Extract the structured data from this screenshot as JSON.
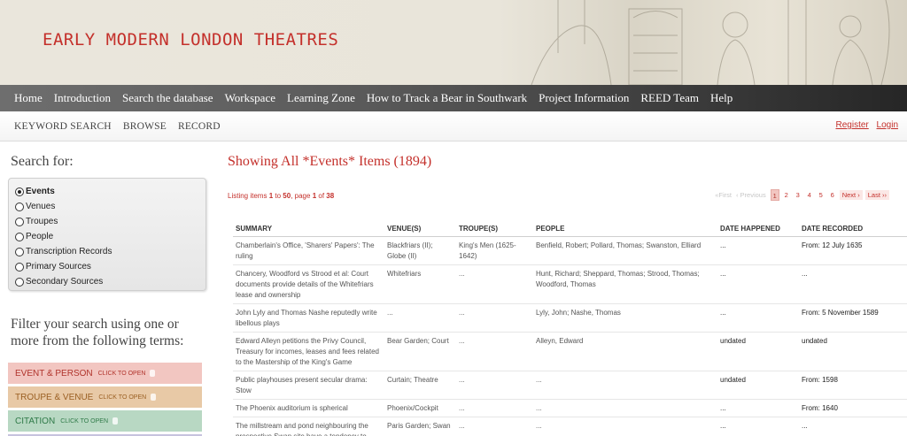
{
  "site": {
    "title": "EARLY MODERN LONDON THEATRES"
  },
  "mainnav": [
    "Home",
    "Introduction",
    "Search the database",
    "Workspace",
    "Learning Zone",
    "How to Track a Bear in Southwark",
    "Project Information",
    "REED Team",
    "Help"
  ],
  "subnav": [
    "KEYWORD SEARCH",
    "BROWSE",
    "RECORD"
  ],
  "auth": {
    "register": "Register",
    "login": "Login"
  },
  "sidebar": {
    "search_for": "Search for:",
    "options": [
      {
        "label": "Events",
        "selected": true
      },
      {
        "label": "Venues",
        "selected": false
      },
      {
        "label": "Troupes",
        "selected": false
      },
      {
        "label": "People",
        "selected": false
      },
      {
        "label": "Transcription Records",
        "selected": false
      },
      {
        "label": "Primary Sources",
        "selected": false
      },
      {
        "label": "Secondary Sources",
        "selected": false
      }
    ],
    "filter_heading": "Filter your search using one or more from the following terms:",
    "click_hint": "CLICK TO OPEN",
    "panes": [
      {
        "label": "EVENT & PERSON",
        "color": "#f2c6c1"
      },
      {
        "label": "TROUPE & VENUE",
        "color": "#e8c9a6"
      },
      {
        "label": "CITATION",
        "color": "#b8d8c3"
      }
    ]
  },
  "main": {
    "heading": "Showing All *Events* Items (1894)",
    "listing": {
      "prefix": "Listing items",
      "from": "1",
      "to_word": "to",
      "to": "50",
      "page_word": ", page",
      "page": "1",
      "of_word": "of",
      "total": "38"
    },
    "pager": {
      "first": "«First",
      "previous": "‹ Previous",
      "pages": [
        "1",
        "2",
        "3",
        "4",
        "5",
        "6"
      ],
      "current": "1",
      "next": "Next ›",
      "last": "Last ››"
    },
    "columns": [
      "SUMMARY",
      "VENUE(S)",
      "TROUPE(S)",
      "PEOPLE",
      "DATE HAPPENED",
      "DATE RECORDED"
    ],
    "rows": [
      [
        "Chamberlain's Office, 'Sharers' Papers': The ruling",
        "Blackfriars (II); Globe (II)",
        "King's Men (1625-1642)",
        "Benfield, Robert; Pollard, Thomas; Swanston, Elliard",
        "...",
        "From: 12 July 1635"
      ],
      [
        "Chancery, Woodford vs Strood et al: Court documents provide details of the Whitefriars lease and ownership",
        "Whitefriars",
        "...",
        "Hunt, Richard; Sheppard, Thomas; Strood, Thomas; Woodford, Thomas",
        "...",
        "..."
      ],
      [
        "John Lyly and Thomas Nashe reputedly write libellous plays",
        "...",
        "...",
        "Lyly, John; Nashe, Thomas",
        "...",
        "From: 5 November 1589"
      ],
      [
        "Edward Alleyn petitions the Privy Council, Treasury for incomes, leases and fees related to the Mastership of the King's Game",
        "Bear Garden; Court",
        "...",
        "Alleyn, Edward",
        "undated",
        "undated"
      ],
      [
        "Public playhouses present secular drama: Stow",
        "Curtain; Theatre",
        "...",
        "...",
        "undated",
        "From: 1598"
      ],
      [
        "The Phoenix auditorium is spherical",
        "Phoenix/Cockpit",
        "...",
        "...",
        "...",
        "From: 1640"
      ],
      [
        "The millstream and pond neighbouring the prospective Swan site have a tendency to",
        "Paris Garden; Swan",
        "...",
        "...",
        "...",
        "..."
      ]
    ]
  }
}
